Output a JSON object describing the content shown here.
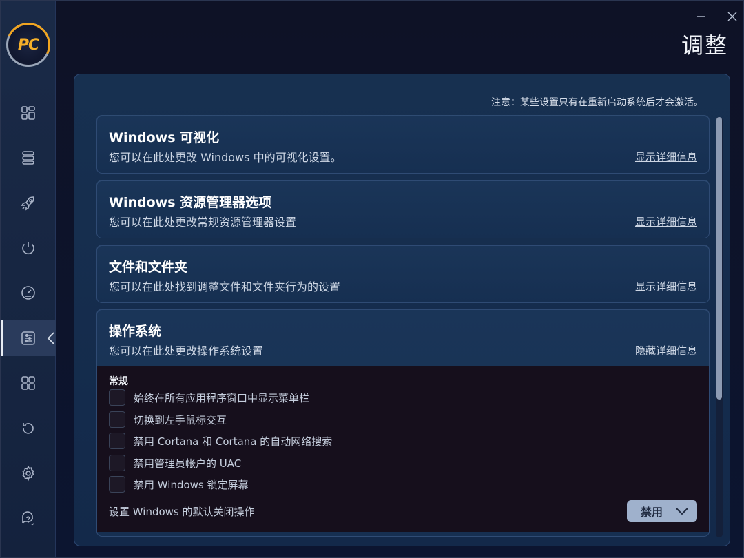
{
  "app": {
    "logo_text": "PC",
    "page_title": "调整"
  },
  "sidebar": {
    "items": [
      {
        "icon": "dashboard-icon"
      },
      {
        "icon": "list-icon"
      },
      {
        "icon": "rocket-icon"
      },
      {
        "icon": "power-icon"
      },
      {
        "icon": "speedometer-icon"
      },
      {
        "icon": "tweaks-icon",
        "active": true
      },
      {
        "icon": "apps-icon"
      },
      {
        "icon": "restore-icon"
      },
      {
        "icon": "gear-icon"
      },
      {
        "icon": "support-icon"
      }
    ]
  },
  "notice": "注意：某些设置只有在重新启动系统后才会激活。",
  "cards": [
    {
      "title": "Windows 可视化",
      "desc": "您可以在此处更改 Windows 中的可视化设置。",
      "link": "显示详细信息"
    },
    {
      "title": "Windows 资源管理器选项",
      "desc": "您可以在此处更改常规资源管理器设置",
      "link": "显示详细信息"
    },
    {
      "title": "文件和文件夹",
      "desc": "您可以在此处找到调整文件和文件夹行为的设置",
      "link": "显示详细信息"
    },
    {
      "title": "操作系统",
      "desc": "您可以在此处更改操作系统设置",
      "link": "隐藏详细信息"
    }
  ],
  "os_section": {
    "label": "常规",
    "options": [
      "始终在所有应用程序窗口中显示菜单栏",
      "切换到左手鼠标交互",
      "禁用 Cortana 和 Cortana 的自动网络搜索",
      "禁用管理员帐户的 UAC",
      "禁用 Windows 锁定屏幕"
    ],
    "shutdown_label": "设置 Windows 的默认关闭操作",
    "shutdown_value": "禁用"
  },
  "colors": {
    "accent_orange": "#f2a51f",
    "panel_bg": "#173050",
    "dropdown_bg": "#9fb1cc"
  }
}
